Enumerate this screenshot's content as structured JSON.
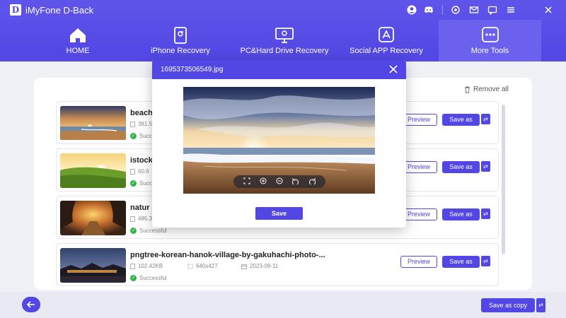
{
  "app": {
    "logo_letter": "D",
    "title": "iMyFone D-Back"
  },
  "titlebar_icons": [
    "account-icon",
    "discord-icon",
    "settings-icon",
    "mail-icon",
    "chat-icon",
    "menu-icon",
    "close-icon"
  ],
  "nav": {
    "items": [
      {
        "label": "HOME",
        "icon": "home-icon"
      },
      {
        "label": "iPhone Recovery",
        "icon": "phone-recovery-icon"
      },
      {
        "label": "PC&Hard Drive Recovery",
        "icon": "pc-recovery-icon"
      },
      {
        "label": "Social APP Recovery",
        "icon": "app-store-icon"
      },
      {
        "label": "More Tools",
        "icon": "more-tools-icon",
        "active": true
      }
    ]
  },
  "toolbar": {
    "remove_all": "Remove all"
  },
  "files": [
    {
      "name": "beach",
      "size": "381.5",
      "status": "Successful",
      "preview_label": "Preview",
      "save_label": "Save as"
    },
    {
      "name": "istock",
      "size": "60.6",
      "status": "Succ",
      "preview_label": "Preview",
      "save_label": "Save as"
    },
    {
      "name": "natur",
      "size": "485.3",
      "status": "Successful",
      "preview_label": "Preview",
      "save_label": "Save as"
    },
    {
      "name": "pngtree-korean-hanok-village-by-gakuhachi-photo-...",
      "size": "102.42KB",
      "dimensions": "640x427",
      "date": "2023-09-11",
      "status": "Successful",
      "preview_label": "Preview",
      "save_label": "Save as"
    }
  ],
  "bottom": {
    "save_copy_label": "Save as copy"
  },
  "modal": {
    "title": "1695373506549.jpg",
    "save_label": "Save",
    "tools": [
      "fullscreen-icon",
      "zoom-in-icon",
      "zoom-out-icon",
      "rotate-left-icon",
      "rotate-right-icon"
    ]
  },
  "colors": {
    "brand": "#5246e4",
    "success": "#2fb64a"
  }
}
